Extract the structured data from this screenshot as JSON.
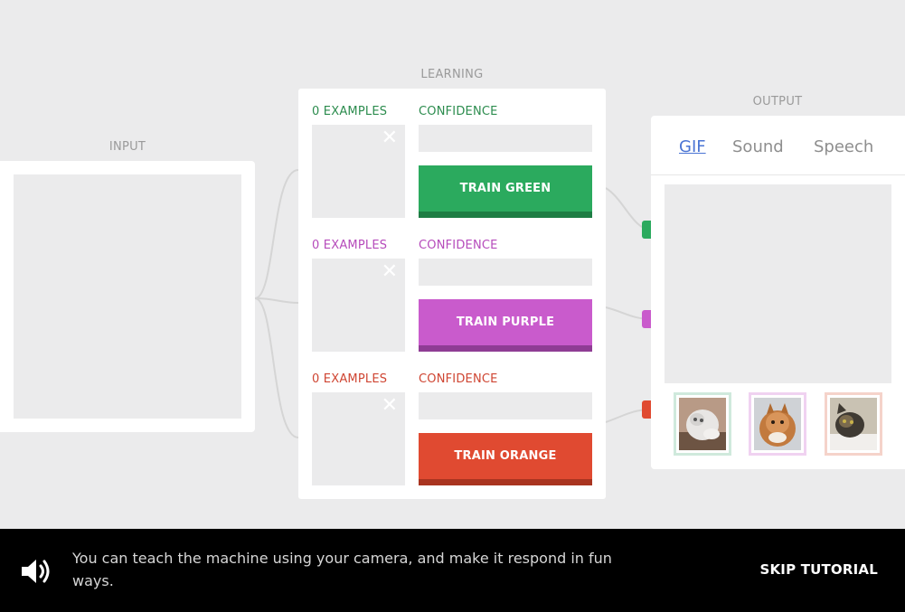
{
  "labels": {
    "input": "INPUT",
    "learning": "LEARNING",
    "output": "OUTPUT"
  },
  "classes": [
    {
      "examples": "0 EXAMPLES",
      "confidence": "CONFIDENCE",
      "button": "TRAIN GREEN",
      "color": "#2baa5e",
      "shadow": "#1e7d44",
      "text_color": "#2c8c4e"
    },
    {
      "examples": "0 EXAMPLES",
      "confidence": "CONFIDENCE",
      "button": "TRAIN PURPLE",
      "color": "#c95bcc",
      "shadow": "#8f3c94",
      "text_color": "#b64bbb"
    },
    {
      "examples": "0 EXAMPLES",
      "confidence": "CONFIDENCE",
      "button": "TRAIN ORANGE",
      "color": "#e04a31",
      "shadow": "#a93420",
      "text_color": "#cf4532"
    }
  ],
  "output": {
    "tabs": [
      "GIF",
      "Sound",
      "Speech"
    ],
    "active_tab": "GIF"
  },
  "thumbnails": [
    {
      "name": "cat-gif-thumbnail-1",
      "border": "#cfe9dc"
    },
    {
      "name": "cat-gif-thumbnail-2",
      "border": "#f0d2f1"
    },
    {
      "name": "cat-gif-thumbnail-3",
      "border": "#f5d3ca"
    }
  ],
  "footer": {
    "message": "You can teach the machine using your camera, and make it respond in fun ways.",
    "skip": "SKIP TUTORIAL"
  }
}
